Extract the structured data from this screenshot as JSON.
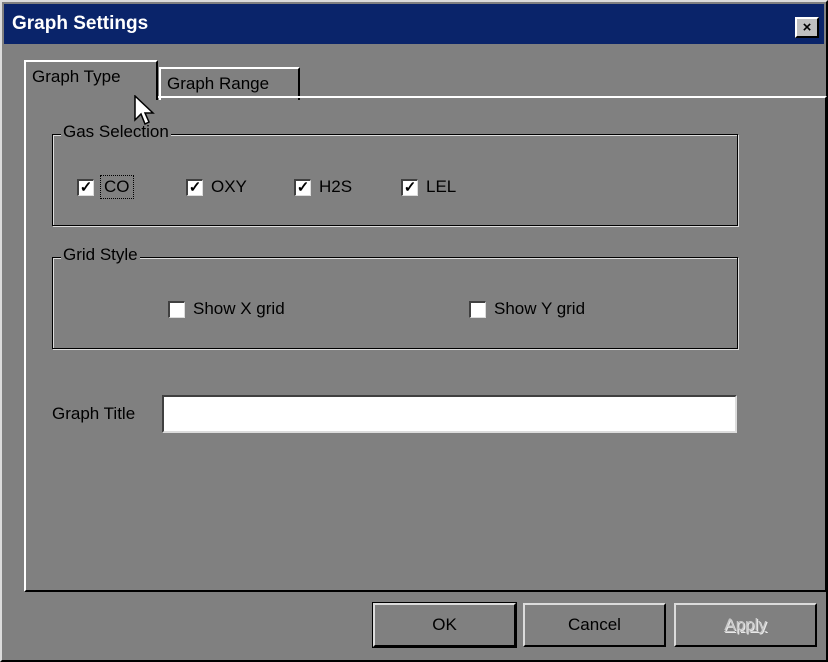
{
  "window": {
    "title": "Graph Settings",
    "close_glyph": "×"
  },
  "tabs": [
    {
      "label": "Graph Type",
      "active": true
    },
    {
      "label": "Graph Range",
      "active": false
    }
  ],
  "gas_selection": {
    "label": "Gas Selection",
    "items": [
      {
        "label": "CO",
        "checked": true
      },
      {
        "label": "OXY",
        "checked": true
      },
      {
        "label": "H2S",
        "checked": true
      },
      {
        "label": "LEL",
        "checked": true
      }
    ]
  },
  "grid_style": {
    "label": "Grid Style",
    "show_x": {
      "label": "Show X grid",
      "checked": false
    },
    "show_y": {
      "label": "Show Y grid",
      "checked": false
    }
  },
  "graph_title": {
    "label": "Graph Title",
    "value": ""
  },
  "buttons": {
    "ok": "OK",
    "cancel": "Cancel",
    "apply": "Apply"
  },
  "check_glyph": "✓",
  "colors": {
    "titlebar": "#0a246a",
    "face": "#808080",
    "highlight": "#dcdcdc"
  }
}
